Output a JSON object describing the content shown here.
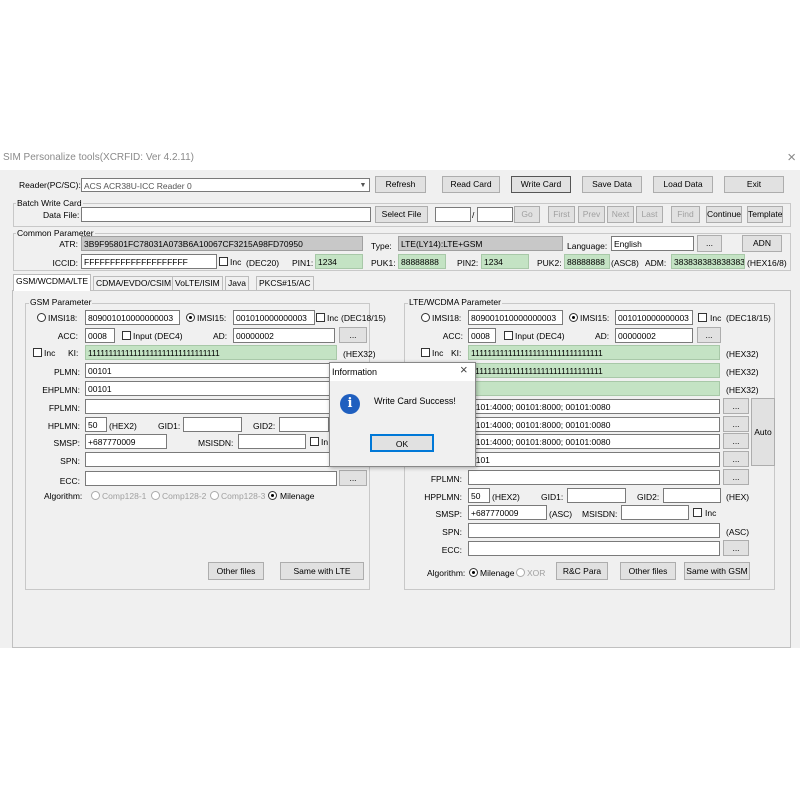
{
  "window": {
    "title": "SIM Personalize tools(XCRFID: Ver 4.2.11)",
    "close_glyph": "×"
  },
  "reader": {
    "label": "Reader(PC/SC):",
    "value": "ACS ACR38U-ICC Reader 0",
    "arrow": "▼",
    "buttons": [
      "Refresh",
      "Read Card",
      "Write Card",
      "Save Data",
      "Load Data",
      "Exit"
    ]
  },
  "batch": {
    "group": "Batch Write Card",
    "data_file_label": "Data File:",
    "data_file_value": "",
    "select_file": "Select File",
    "slash": "/",
    "go": "Go",
    "nav": [
      "First",
      "Prev",
      "Next",
      "Last",
      "Find"
    ],
    "continue": "Continue",
    "template": "Template"
  },
  "common": {
    "group": "Common Parameter",
    "atr_label": "ATR:",
    "atr": "3B9F95801FC78031A073B6A10067CF3215A98FD70950",
    "type_label": "Type:",
    "type": "LTE(LY14):LTE+GSM",
    "lang_label": "Language:",
    "lang": "English",
    "dots": "...",
    "adn": "ADN",
    "iccid_label": "ICCID:",
    "iccid": "FFFFFFFFFFFFFFFFFFFF",
    "inc_label": "Inc",
    "dec20": "(DEC20)",
    "pin1_label": "PIN1:",
    "pin1": "1234",
    "puk1_label": "PUK1:",
    "puk1": "88888888",
    "pin2_label": "PIN2:",
    "pin2": "1234",
    "puk2_label": "PUK2:",
    "puk2": "88888888",
    "asc8": "(ASC8)",
    "adm_label": "ADM:",
    "adm": "3838383838383838",
    "hex168": "(HEX16/8)"
  },
  "tabs": [
    "GSM/WCDMA/LTE",
    "CDMA/EVDO/CSIM",
    "VoLTE/ISIM",
    "Java",
    "PKCS#15/AC"
  ],
  "gsm": {
    "group": "GSM Parameter",
    "imsi18_label": "IMSI18:",
    "imsi18": "809001010000000003",
    "imsi15_label": "IMSI15:",
    "imsi15": "001010000000003",
    "inc": "Inc",
    "dec1815": "(DEC18/15)",
    "acc_label": "ACC:",
    "acc": "0008",
    "input_dec4": "Input (DEC4)",
    "ad_label": "AD:",
    "ad": "00000002",
    "dots": "...",
    "ki_label": "KI:",
    "ki": "11111111111111111111111111111111",
    "hex32": "(HEX32)",
    "plmn_label": "PLMN:",
    "plmn": "00101",
    "ehplmn_label": "EHPLMN:",
    "ehplmn": "00101",
    "fplmn_label": "FPLMN:",
    "hplmn_label": "HPLMN:",
    "hplmn": "50",
    "hex2": "(HEX2)",
    "gid1_label": "GID1:",
    "gid2_label": "GID2:",
    "smsp_label": "SMSP:",
    "smsp": "+687770009",
    "msisdn_label": "MSISDN:",
    "in": "In",
    "spn_label": "SPN:",
    "ecc_label": "ECC:",
    "algo_label": "Algorithm:",
    "algos": [
      "Comp128-1",
      "Comp128-2",
      "Comp128-3",
      "Milenage"
    ],
    "other_files": "Other files",
    "same_lte": "Same with LTE"
  },
  "lte": {
    "group": "LTE/WCDMA Parameter",
    "imsi18_label": "IMSI18:",
    "imsi18": "809001010000000003",
    "imsi15_label": "IMSI15:",
    "imsi15": "001010000000003",
    "inc": "Inc",
    "dec1815": "(DEC18/15)",
    "acc_label": "ACC:",
    "acc": "0008",
    "input_dec4": "Input (DEC4)",
    "ad_label": "AD:",
    "ad": "00000002",
    "dots": "...",
    "ki_label": "KI:",
    "ki": "11111111111111111111111111111111",
    "opc": "11111111111111111111111111111111",
    "hex32": "(HEX32)",
    "plmn_row1": "0101:4000; 00101:8000; 00101:0080",
    "plmn_row2": "0101:4000; 00101:8000; 00101:0080",
    "ehplmn_part": "0101",
    "auto": "Auto",
    "fplmn_label": "FPLMN:",
    "hpplmn_label": "HPPLMN:",
    "hpplmn": "50",
    "hex2": "(HEX2)",
    "gid1_label": "GID1:",
    "gid2_label": "GID2:",
    "hex": "(HEX)",
    "smsp_label": "SMSP:",
    "smsp": "+687770009",
    "asc": "(ASC)",
    "msisdn_label": "MSISDN:",
    "spn_label": "SPN:",
    "ecc_label": "ECC:",
    "algo_label": "Algorithm:",
    "milenage": "Milenage",
    "xor": "XOR",
    "rc_para": "R&C Para",
    "other_files": "Other files",
    "same_gsm": "Same with GSM"
  },
  "dialog": {
    "title": "Information",
    "close": "×",
    "message": "Write Card Success!",
    "ok": "OK",
    "icon_letter": "i"
  },
  "colors": {
    "field_green": "#c4e3c4",
    "field_gray": "#c8c8c8",
    "info_blue": "#1f5fbf"
  }
}
